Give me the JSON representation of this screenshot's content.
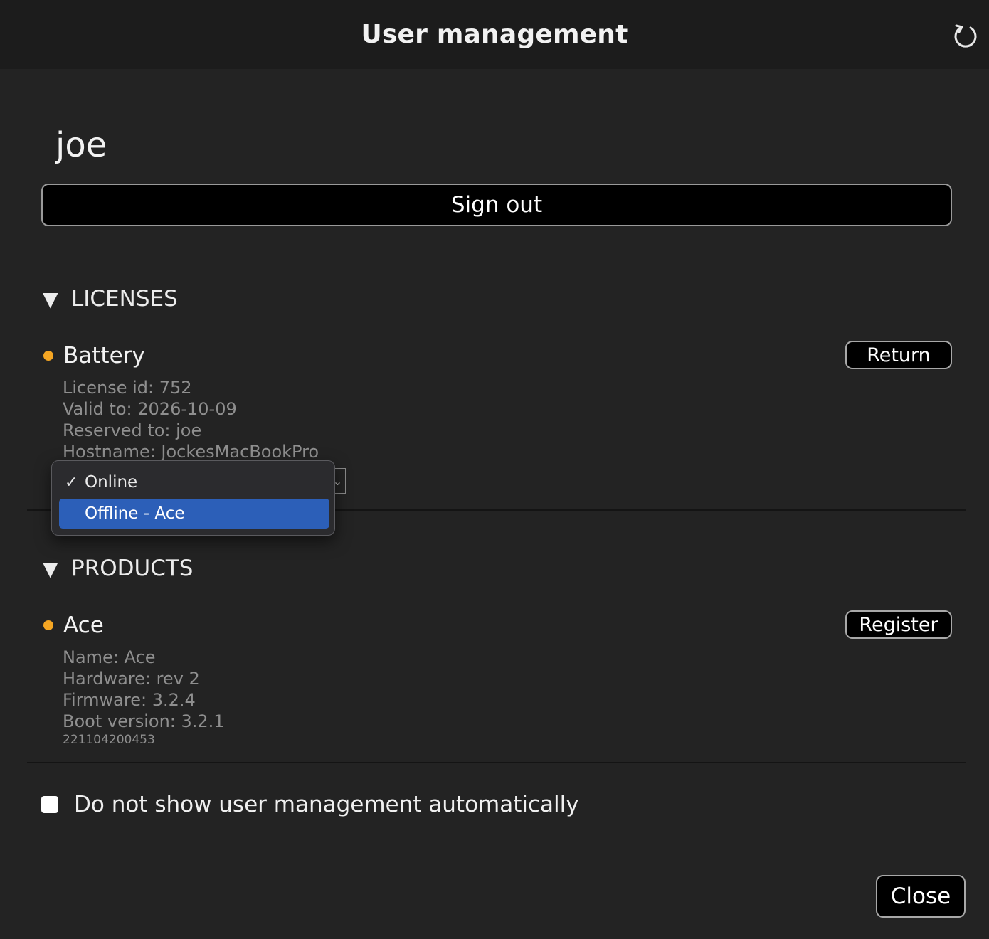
{
  "window": {
    "title": "User management",
    "refresh_icon": "refresh-icon"
  },
  "user": {
    "name": "joe",
    "signout_label": "Sign out"
  },
  "licenses": {
    "header": "LICENSES",
    "toggle_glyph": "▼",
    "item": {
      "name": "Battery",
      "status_color": "#f5a623",
      "action_label": "Return",
      "details": [
        "License id: 752",
        "Valid to: 2026-10-09",
        "Reserved to: joe",
        "Hostname: JockesMacBookPro"
      ]
    },
    "mode_select": {
      "options": [
        {
          "label": "Online",
          "checked": true,
          "check_glyph": "✓"
        },
        {
          "label": "Offline - Ace",
          "highlighted": true
        }
      ]
    }
  },
  "products": {
    "header": "PRODUCTS",
    "toggle_glyph": "▼",
    "item": {
      "name": "Ace",
      "status_color": "#f5a623",
      "action_label": "Register",
      "details": [
        "Name: Ace",
        "Hardware: rev 2",
        "Firmware: 3.2.4",
        "Boot version: 3.2.1"
      ],
      "serial": "221104200453"
    }
  },
  "auto_show": {
    "label": "Do not show user management automatically",
    "checked": false
  },
  "footer": {
    "close_label": "Close"
  }
}
